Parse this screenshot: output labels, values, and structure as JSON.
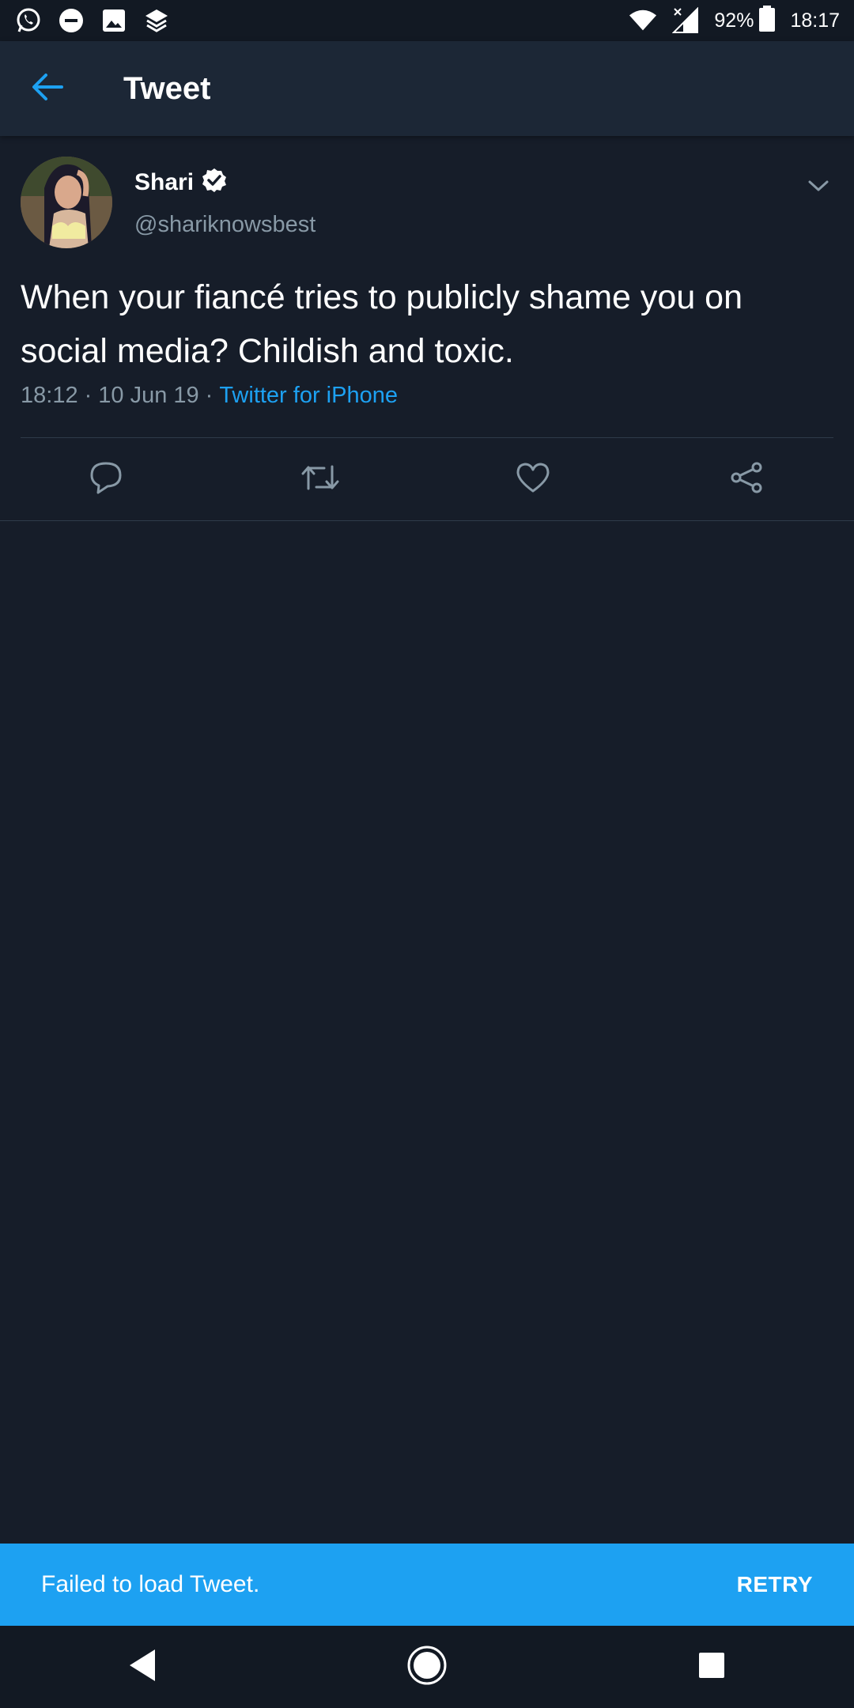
{
  "status_bar": {
    "left_icons": [
      "whatsapp-icon",
      "do-not-disturb-icon",
      "image-icon",
      "layers-icon"
    ],
    "battery_percent": "92%",
    "time": "18:17"
  },
  "app_bar": {
    "title": "Tweet"
  },
  "tweet": {
    "display_name": "Shari",
    "verified": true,
    "handle": "@shariknowsbest",
    "text": "When your fiancé tries to publicly shame you on social media? Childish and toxic.",
    "time": "18:12",
    "date": "10 Jun 19",
    "separator": "·",
    "source": "Twitter for iPhone"
  },
  "snackbar": {
    "message": "Failed to load Tweet.",
    "action": "RETRY"
  },
  "colors": {
    "background": "#161d29",
    "app_bar": "#1c2736",
    "accent": "#1da1f2",
    "secondary_text": "#8899a6"
  }
}
